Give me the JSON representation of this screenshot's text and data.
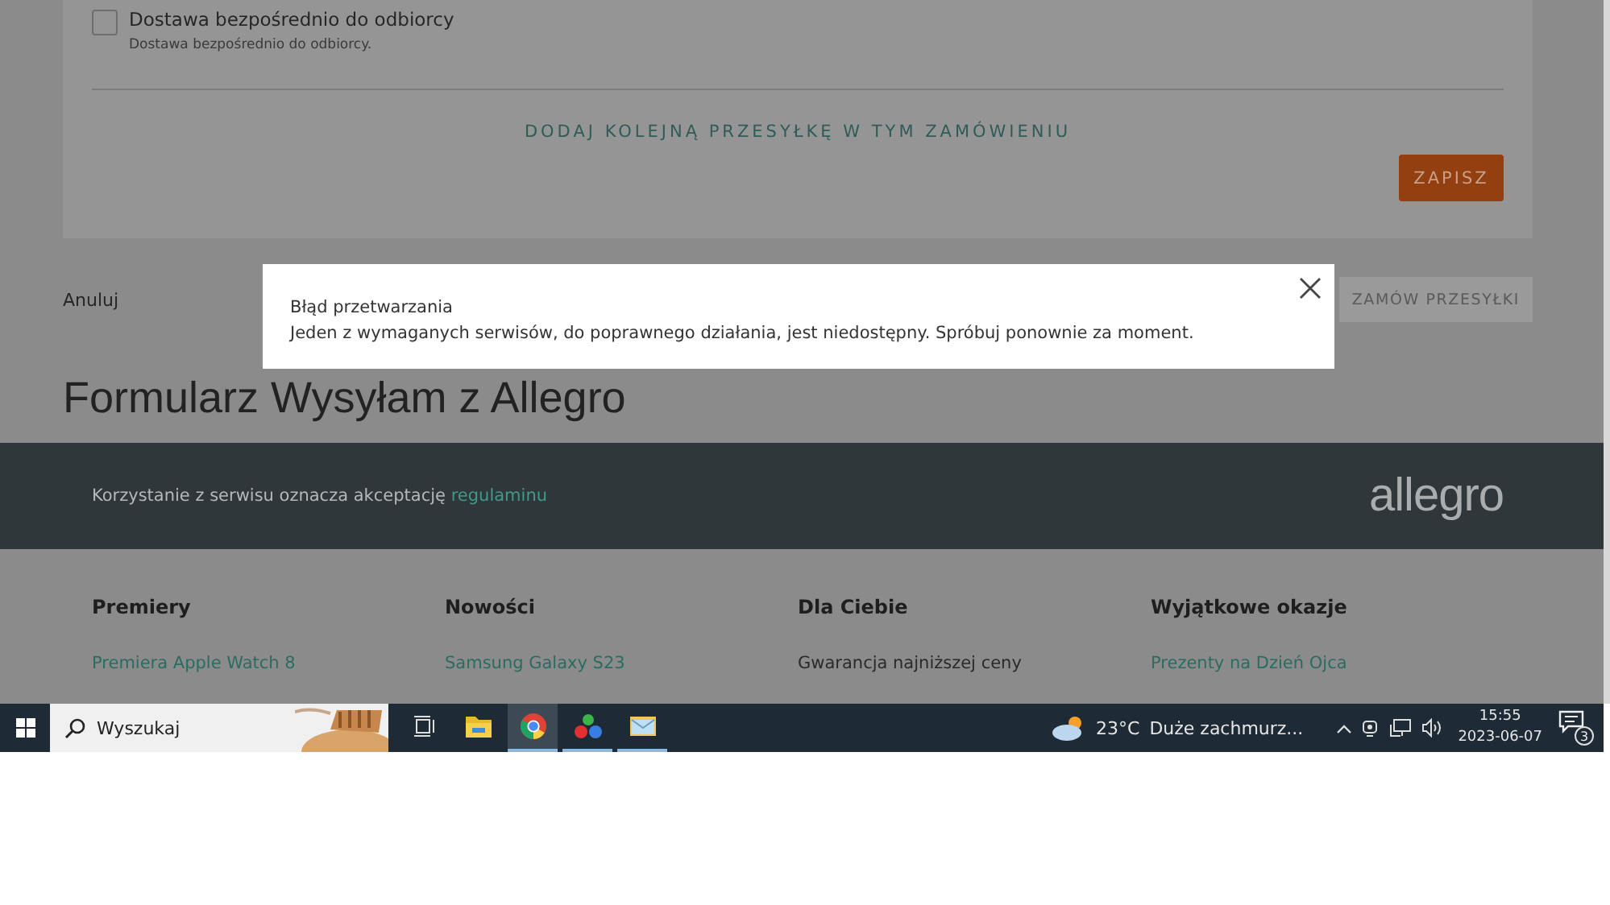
{
  "delivery_option": {
    "label": "Dostawa bezpośrednio do odbiorcy",
    "description": "Dostawa bezpośrednio do odbiorcy.",
    "checked": false
  },
  "add_shipment_link": "DODAJ KOLEJNĄ PRZESYŁKĘ W TYM ZAMÓWIENIU",
  "save_button": "ZAPISZ",
  "cancel_link": "Anuluj",
  "order_button": {
    "label": "ZAMÓW PRZESYŁKI",
    "disabled": true
  },
  "page_title": "Formularz Wysyłam z Allegro",
  "footer": {
    "notice": "Korzystanie z serwisu oznacza akceptację",
    "link": "regulaminu",
    "logo": "allegro"
  },
  "footer_columns": [
    {
      "heading": "Premiery",
      "links": [
        {
          "text": "Premiera Apple Watch 8",
          "kind": "link"
        }
      ]
    },
    {
      "heading": "Nowości",
      "links": [
        {
          "text": "Samsung Galaxy S23",
          "kind": "link"
        }
      ]
    },
    {
      "heading": "Dla Ciebie",
      "links": [
        {
          "text": "Gwarancja najniższej ceny",
          "kind": "text"
        }
      ]
    },
    {
      "heading": "Wyjątkowe okazje",
      "links": [
        {
          "text": "Prezenty na Dzień Ojca",
          "kind": "link"
        }
      ]
    }
  ],
  "dialog": {
    "title": "Błąd przetwarzania",
    "message": "Jeden z wymaganych serwisów, do poprawnego działania, jest niedostępny. Spróbuj ponownie za moment."
  },
  "taskbar": {
    "search_placeholder": "Wyszukaj",
    "apps": [
      {
        "kind": "task-view",
        "running": false,
        "selected": false
      },
      {
        "kind": "explorer",
        "running": false,
        "selected": false
      },
      {
        "kind": "browser",
        "running": true,
        "selected": true
      },
      {
        "kind": "dots",
        "running": true,
        "selected": false
      },
      {
        "kind": "mail",
        "running": true,
        "selected": false
      }
    ],
    "weather": {
      "temperature": "23°C",
      "condition": "Duże zachmurz..."
    },
    "time": "15:55",
    "date": "2023-06-07",
    "notification_count": "3"
  }
}
